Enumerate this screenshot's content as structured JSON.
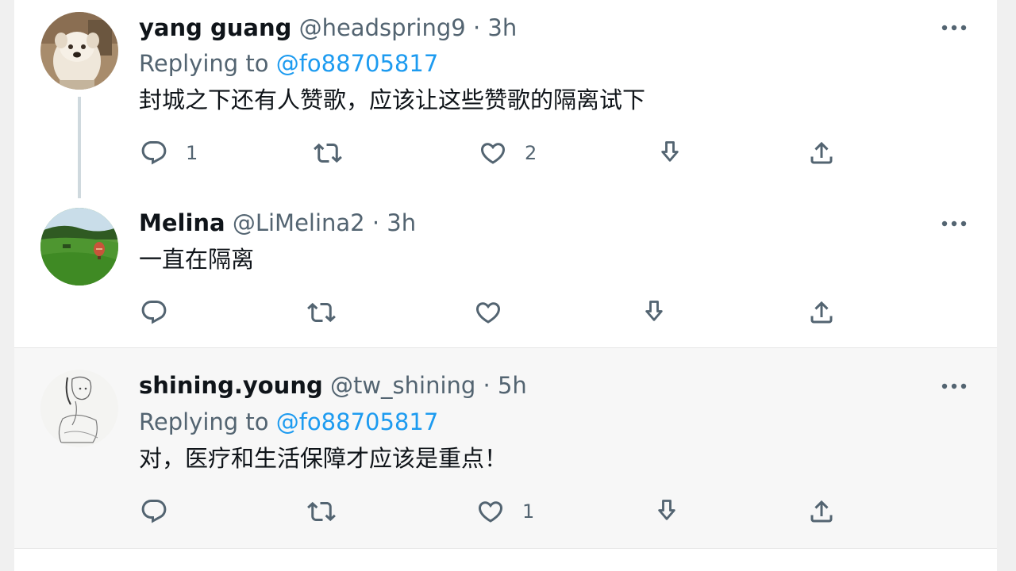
{
  "tweets": [
    {
      "name": "yang guang",
      "handle": "@headspring9",
      "dot": "·",
      "time": "3h",
      "replying_prefix": "Replying to ",
      "replying_to": "@fo88705817",
      "text": "封城之下还有人赞歌，应该让这些赞歌的隔离试下",
      "reply_count": "1",
      "retweet_count": "",
      "like_count": "2"
    },
    {
      "name": "Melina",
      "handle": "@LiMelina2",
      "dot": "·",
      "time": "3h",
      "text": "一直在隔离",
      "reply_count": "",
      "retweet_count": "",
      "like_count": ""
    },
    {
      "name": "shining.young",
      "handle": "@tw_shining",
      "dot": "·",
      "time": "5h",
      "replying_prefix": "Replying to ",
      "replying_to": "@fo88705817",
      "text": "对，医疗和生活保障才应该是重点！",
      "reply_count": "",
      "retweet_count": "",
      "like_count": "1"
    }
  ],
  "colors": {
    "text_primary": "#0f1419",
    "text_secondary": "#536471",
    "link": "#1d9bf0",
    "thread_line": "#cfd9de"
  },
  "icons": [
    "more-icon",
    "reply-icon",
    "retweet-icon",
    "like-icon",
    "download-icon",
    "share-icon"
  ]
}
